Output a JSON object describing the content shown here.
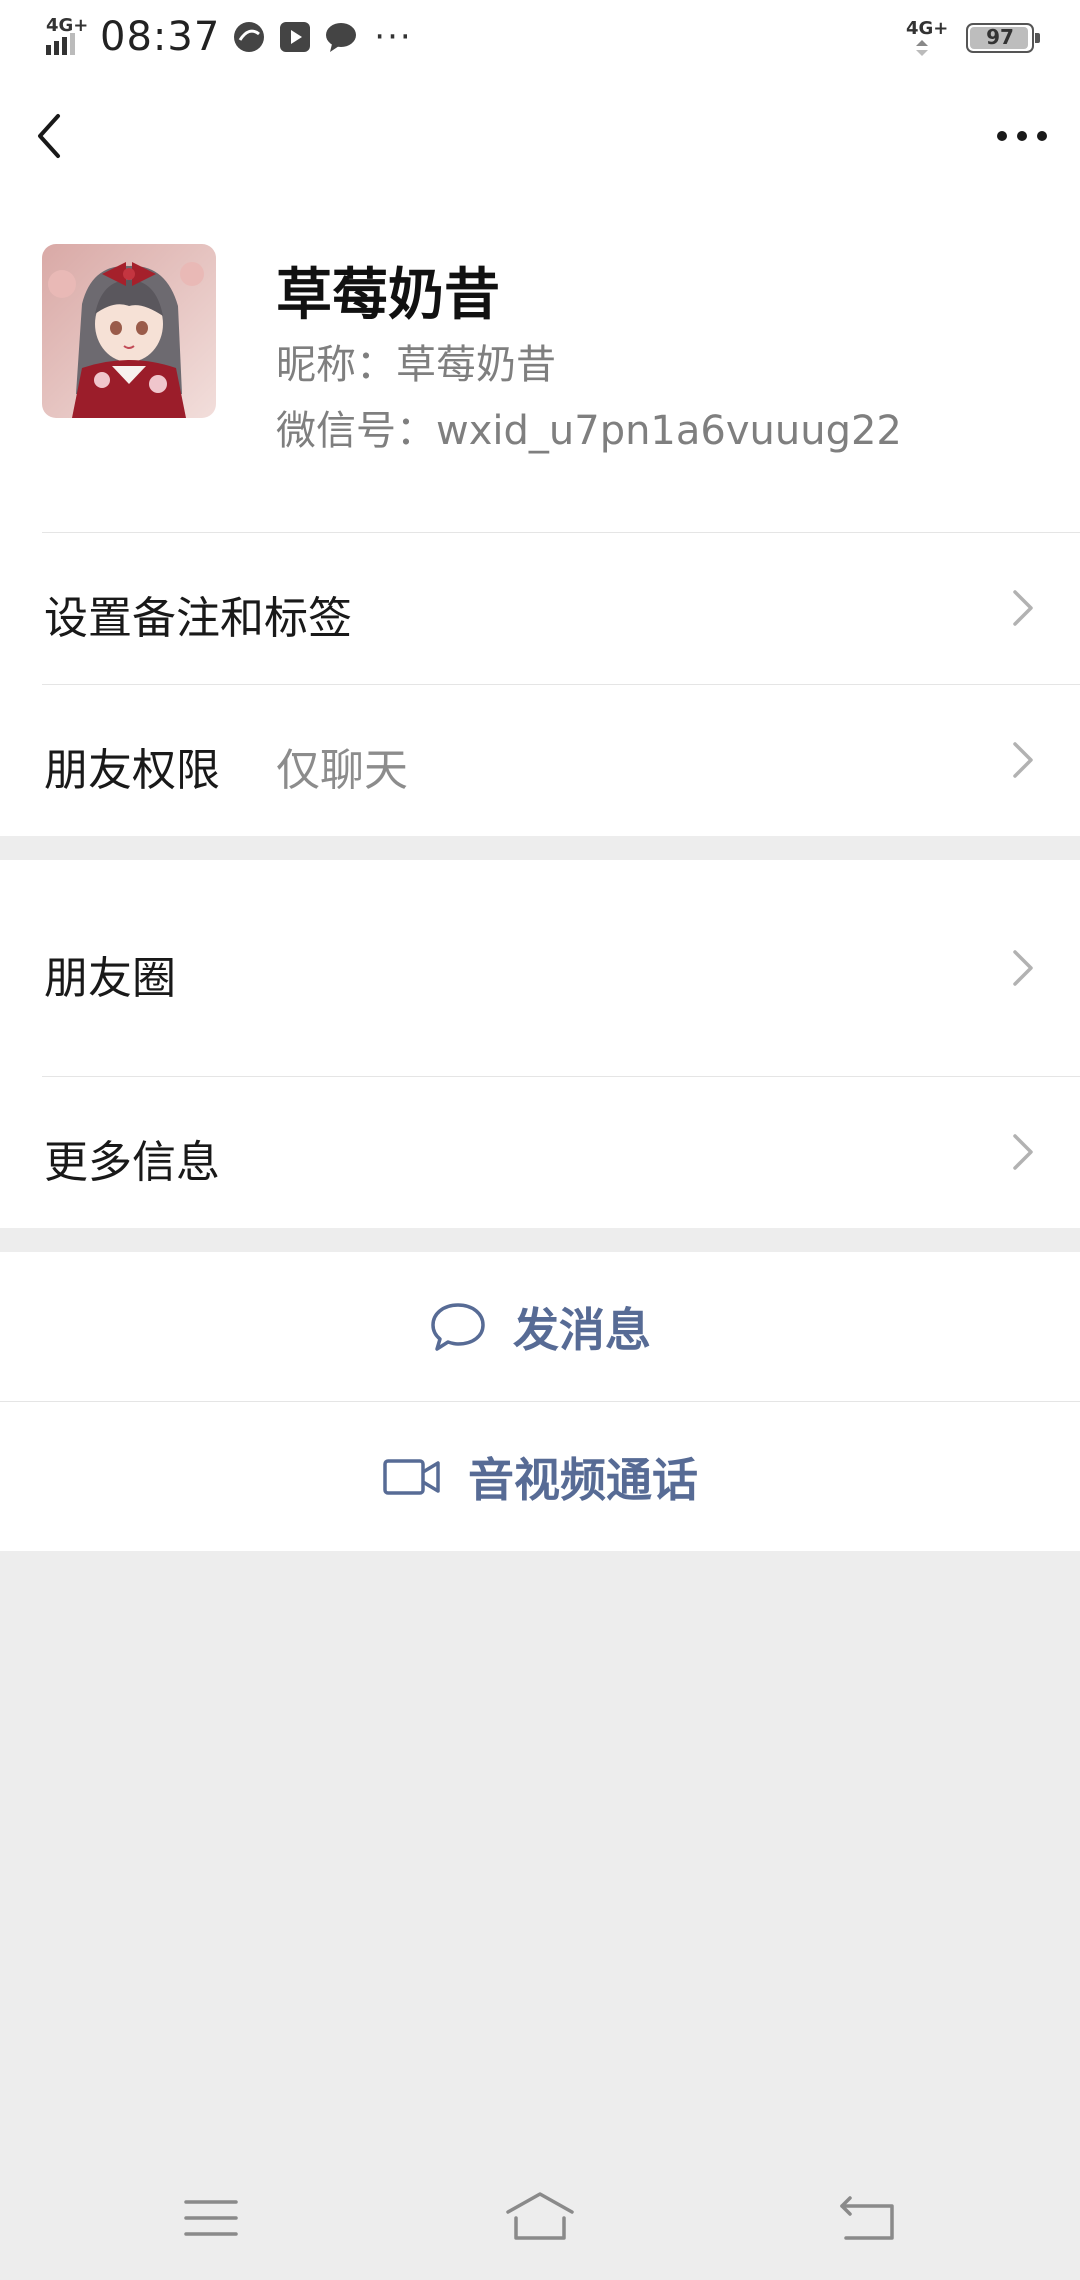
{
  "status_bar": {
    "time": "08:37",
    "network_left": "4G+",
    "network_right": "4G+",
    "battery_level": 97,
    "battery_text": "97",
    "notification_icons": [
      "browser-icon",
      "video-app-icon",
      "chat-bubble-icon"
    ],
    "more": "···"
  },
  "profile": {
    "display_name": "草莓奶昔",
    "nickname_line": "昵称：草莓奶昔",
    "wechat_id_line": "微信号：wxid_u7pn1a6vuuug22"
  },
  "menu": {
    "remark": {
      "label": "设置备注和标签"
    },
    "permission": {
      "label": "朋友权限",
      "value": "仅聊天"
    },
    "moments": {
      "label": "朋友圈"
    },
    "more_info": {
      "label": "更多信息"
    }
  },
  "actions": {
    "message": {
      "label": "发消息",
      "icon": "chat-bubble-icon"
    },
    "call": {
      "label": "音视频通话",
      "icon": "video-camera-icon"
    }
  },
  "colors": {
    "link_blue": "#576b95",
    "background": "#ededed",
    "surface": "#ffffff"
  },
  "system_nav": {
    "icons": [
      "menu-icon",
      "home-icon",
      "back-icon"
    ]
  }
}
